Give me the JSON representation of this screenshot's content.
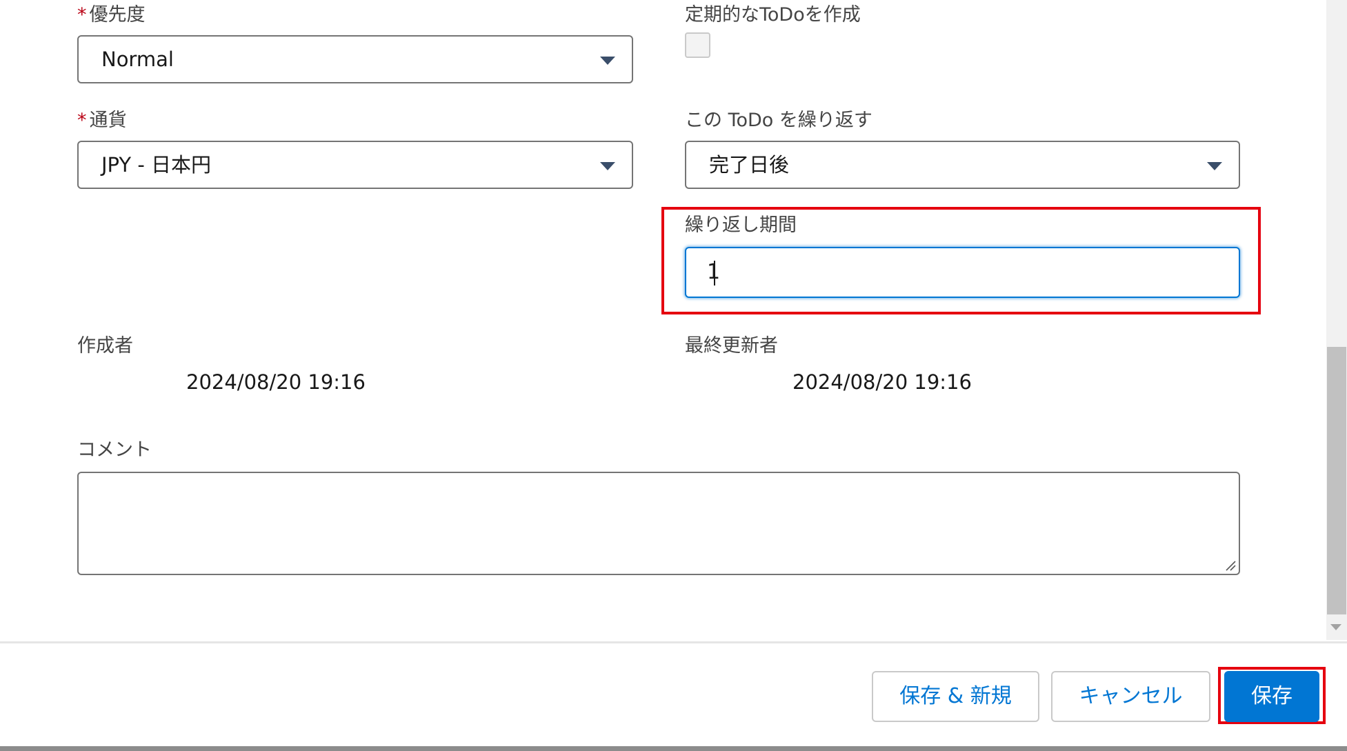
{
  "form": {
    "priority": {
      "required_mark": "*",
      "label": "優先度",
      "value": "Normal"
    },
    "recurring_todo": {
      "label": "定期的なToDoを作成",
      "checked": false
    },
    "currency": {
      "required_mark": "*",
      "label": "通貨",
      "value": "JPY - 日本円"
    },
    "repeat_todo": {
      "label": "この ToDo を繰り返す",
      "value": "完了日後"
    },
    "repeat_interval": {
      "label": "繰り返し期間",
      "value": "1"
    },
    "created_by": {
      "label": "作成者",
      "value": "2024/08/20 19:16"
    },
    "last_modified_by": {
      "label": "最終更新者",
      "value": "2024/08/20 19:16"
    },
    "comment": {
      "label": "コメント",
      "value": ""
    }
  },
  "footer": {
    "save_new_label": "保存 & 新規",
    "cancel_label": "キャンセル",
    "save_label": "保存"
  },
  "colors": {
    "brand_blue": "#0176d3",
    "highlight_red": "#e5000f",
    "required_red": "#ba0517"
  }
}
